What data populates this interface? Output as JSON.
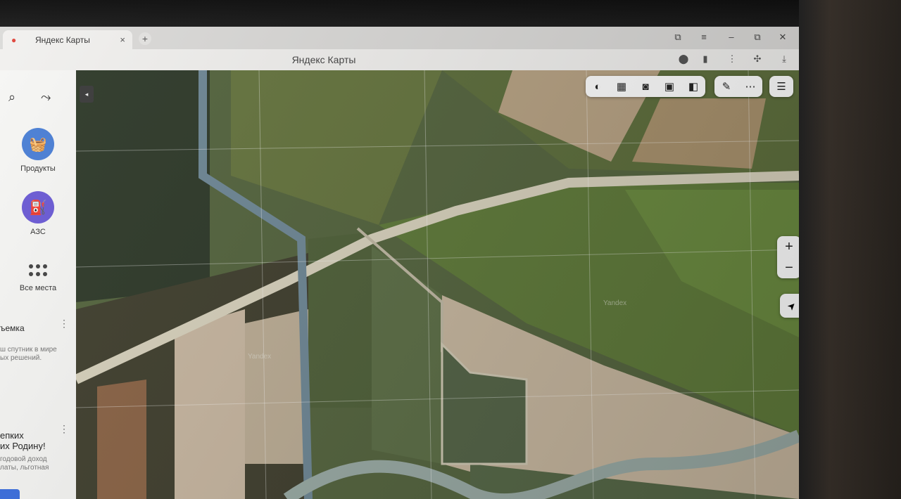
{
  "browser": {
    "tab_title": "Яндекс Карты",
    "tab_close": "×",
    "new_tab": "+",
    "window_title": "Яндекс Карты",
    "minimize": "–",
    "maximize": "⧉",
    "close": "✕",
    "menu": "≡",
    "bookmarks": "⧉"
  },
  "sidebar": {
    "collapse": "◂",
    "categories": [
      {
        "label": "Продукты",
        "icon": "basket-icon",
        "color": "#4a7fd6"
      },
      {
        "label": "АЗС",
        "icon": "fuel-icon",
        "color": "#6b5bd6"
      },
      {
        "label": "Все места",
        "icon": "grid-icon"
      }
    ],
    "promo1": {
      "title": "ъемка",
      "text1": "ш спутник в мире",
      "text2": "ых решений."
    },
    "promo2": {
      "title1": "епких",
      "title2": "их Родину!",
      "text1": "годовой доход",
      "text2": "латы, льготная"
    }
  },
  "map": {
    "watermarks": [
      "Yandex",
      "Yandex"
    ],
    "zoom_in": "+",
    "zoom_out": "−",
    "locate": "➤"
  }
}
